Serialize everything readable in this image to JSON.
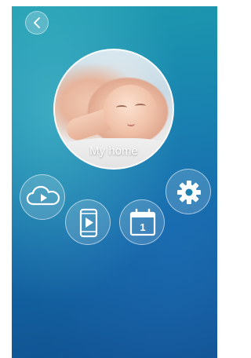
{
  "home": {
    "name": "My home"
  },
  "icons": {
    "back": "chevron-left-icon",
    "cloud": "cloud-play-icon",
    "phone": "phone-play-icon",
    "calendar": "calendar-icon",
    "settings": "gear-icon"
  },
  "calendar": {
    "day": "1"
  },
  "colors": {
    "background_top": "#1f9bb0",
    "background_bottom": "#10508f",
    "icon": "#ffffff"
  }
}
